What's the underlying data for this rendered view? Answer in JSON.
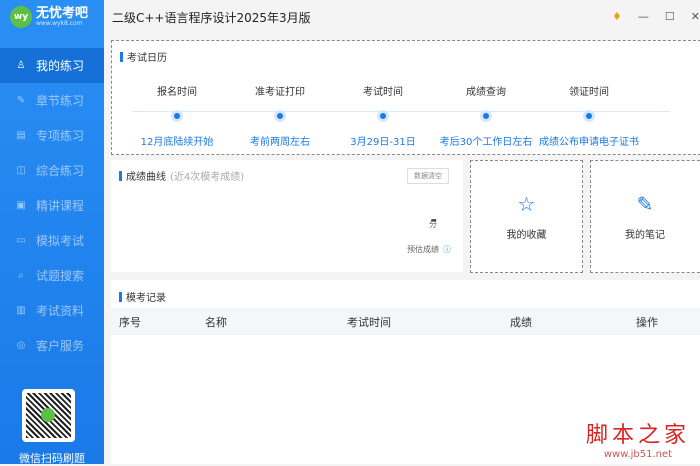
{
  "app": {
    "logo_mark": "wy",
    "logo_name": "无忧考吧",
    "logo_url": "www.wyk8.com",
    "title": "二级C++语言程序设计2025年3月版"
  },
  "sidebar": {
    "items": [
      {
        "label": "我的练习",
        "icon": "user-icon",
        "active": true
      },
      {
        "label": "章节练习",
        "icon": "pencil-icon"
      },
      {
        "label": "专项练习",
        "icon": "document-icon"
      },
      {
        "label": "综合练习",
        "icon": "layers-icon"
      },
      {
        "label": "精讲课程",
        "icon": "book-icon"
      },
      {
        "label": "模拟考试",
        "icon": "monitor-icon"
      },
      {
        "label": "试题搜索",
        "icon": "search-icon"
      },
      {
        "label": "考试资料",
        "icon": "file-icon"
      },
      {
        "label": "客户服务",
        "icon": "service-icon"
      }
    ],
    "qr_label": "微信扫码刷题"
  },
  "calendar": {
    "title": "考试日历",
    "steps": [
      {
        "title": "报名时间",
        "value": "12月底陆续开始"
      },
      {
        "title": "准考证打印",
        "value": "考前两周左右"
      },
      {
        "title": "考试时间",
        "value": "3月29日-31日"
      },
      {
        "title": "成绩查询",
        "value": "考后30个工作日左右"
      },
      {
        "title": "领证时间",
        "value": "成绩公布申请电子证书"
      }
    ]
  },
  "score": {
    "title": "成绩曲线",
    "subtitle": "(近4次模考成绩)",
    "clear_button": "数据清空",
    "value": "-",
    "unit": "分",
    "estimate_label": "预估成绩"
  },
  "cards": {
    "favorites": "我的收藏",
    "notes": "我的笔记"
  },
  "records": {
    "title": "模考记录",
    "columns": [
      "序号",
      "名称",
      "考试时间",
      "成绩",
      "操作"
    ]
  },
  "watermark": {
    "name": "脚本之家",
    "url": "www.jb51.net"
  },
  "colors": {
    "accent": "#1a7ae8"
  }
}
